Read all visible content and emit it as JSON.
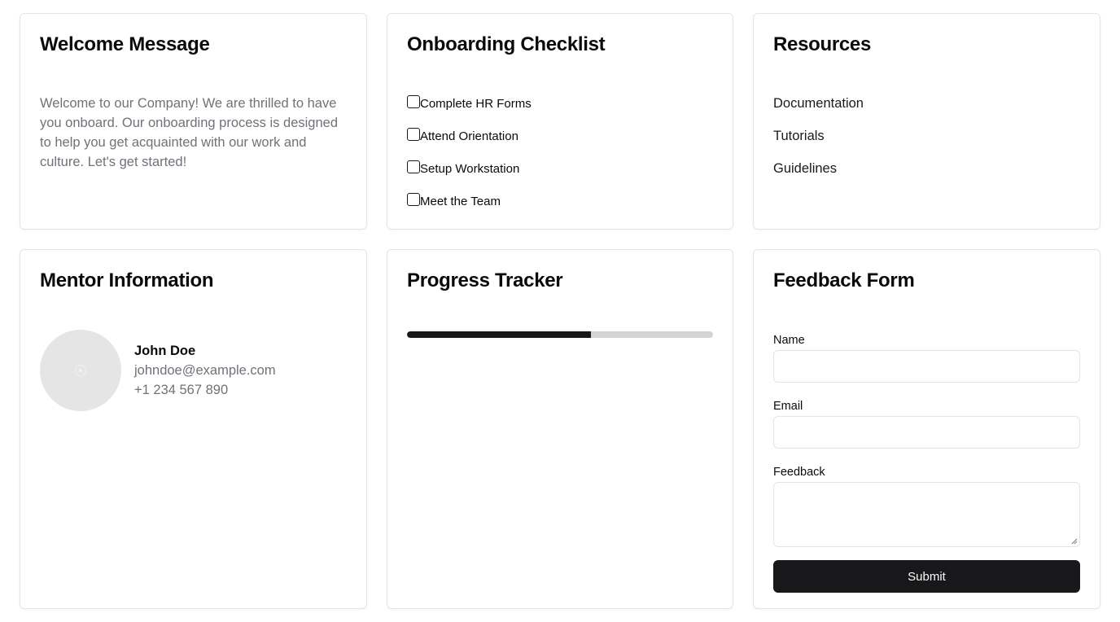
{
  "welcome": {
    "title": "Welcome Message",
    "body": "Welcome to our Company! We are thrilled to have you onboard. Our onboarding process is designed to help you get acquainted with our work and culture. Let's get started!"
  },
  "checklist": {
    "title": "Onboarding Checklist",
    "items": [
      {
        "label": "Complete HR Forms",
        "checked": false
      },
      {
        "label": "Attend Orientation",
        "checked": false
      },
      {
        "label": "Setup Workstation",
        "checked": false
      },
      {
        "label": "Meet the Team",
        "checked": false
      }
    ]
  },
  "resources": {
    "title": "Resources",
    "links": [
      "Documentation",
      "Tutorials",
      "Guidelines"
    ]
  },
  "mentor": {
    "title": "Mentor Information",
    "name": "John Doe",
    "email": "johndoe@example.com",
    "phone": "+1 234 567 890"
  },
  "progress": {
    "title": "Progress Tracker",
    "value": 0.6
  },
  "feedback": {
    "title": "Feedback Form",
    "name_label": "Name",
    "email_label": "Email",
    "feedback_label": "Feedback",
    "submit_label": "Submit"
  }
}
